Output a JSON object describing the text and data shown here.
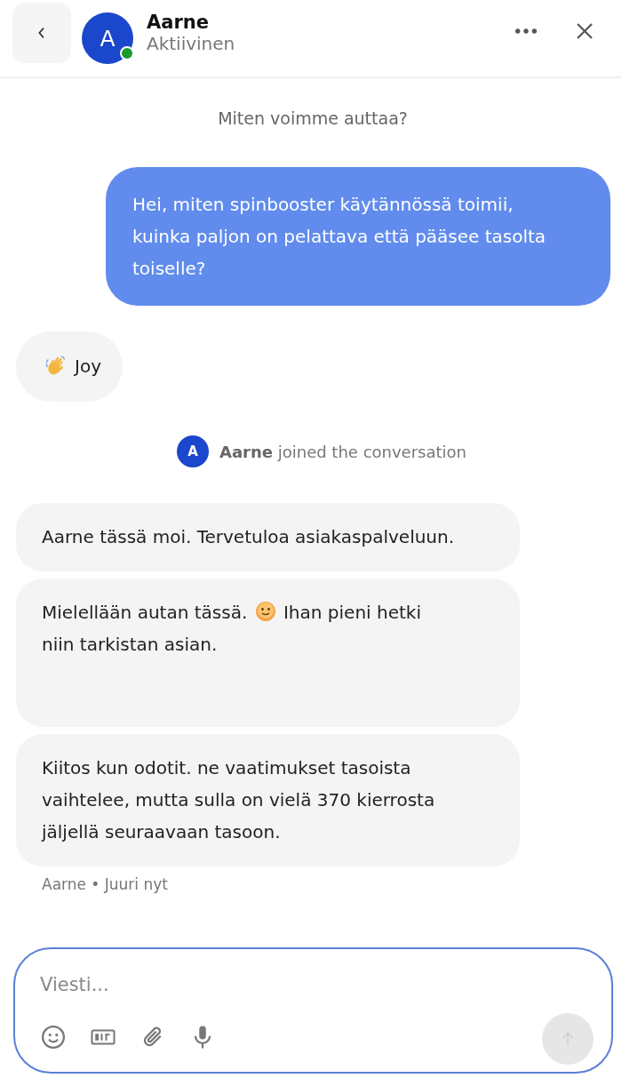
{
  "header": {
    "name": "Aarne",
    "status": "Aktiivinen",
    "online": true,
    "avatar_letter": "A"
  },
  "prompt": "Miten voimme auttaa?",
  "messages": [
    {
      "kind": "user",
      "parts": [
        {
          "text": "Hei, miten spinbooster käytännössä toimii, kuinka paljon on pelattava että pääsee tasolta toiselle?"
        }
      ]
    },
    {
      "kind": "reaction",
      "parts": [
        {
          "text": "Joy"
        }
      ]
    },
    {
      "kind": "event",
      "avatar_letter": "A",
      "text": "**Aarne** joined the conversation"
    },
    {
      "kind": "agent",
      "parts": [
        {
          "text": "Aarne tässä moi. Tervetuloa asiakaspalveluun."
        }
      ]
    },
    {
      "kind": "agent",
      "tall": true,
      "parts": [
        {
          "text": "Mielellään autan tässä."
        },
        {
          "kind": "emoji"
        },
        {
          "text": "Ihan pieni hetki"
        },
        {
          "text": "niin tarkistan asian."
        }
      ]
    },
    {
      "kind": "agent",
      "parts": [
        {
          "text": "Kiitos kun odotit. ne vaatimukset tasoista vaihtelee, mutta sulla on vielä 370 kierrosta jäljellä seuraavaan tasoon."
        }
      ]
    },
    {
      "kind": "meta",
      "text": "Aarne • Juuri nyt"
    }
  ],
  "composer": {
    "placeholder": "Viesti...",
    "send_disabled": true
  }
}
